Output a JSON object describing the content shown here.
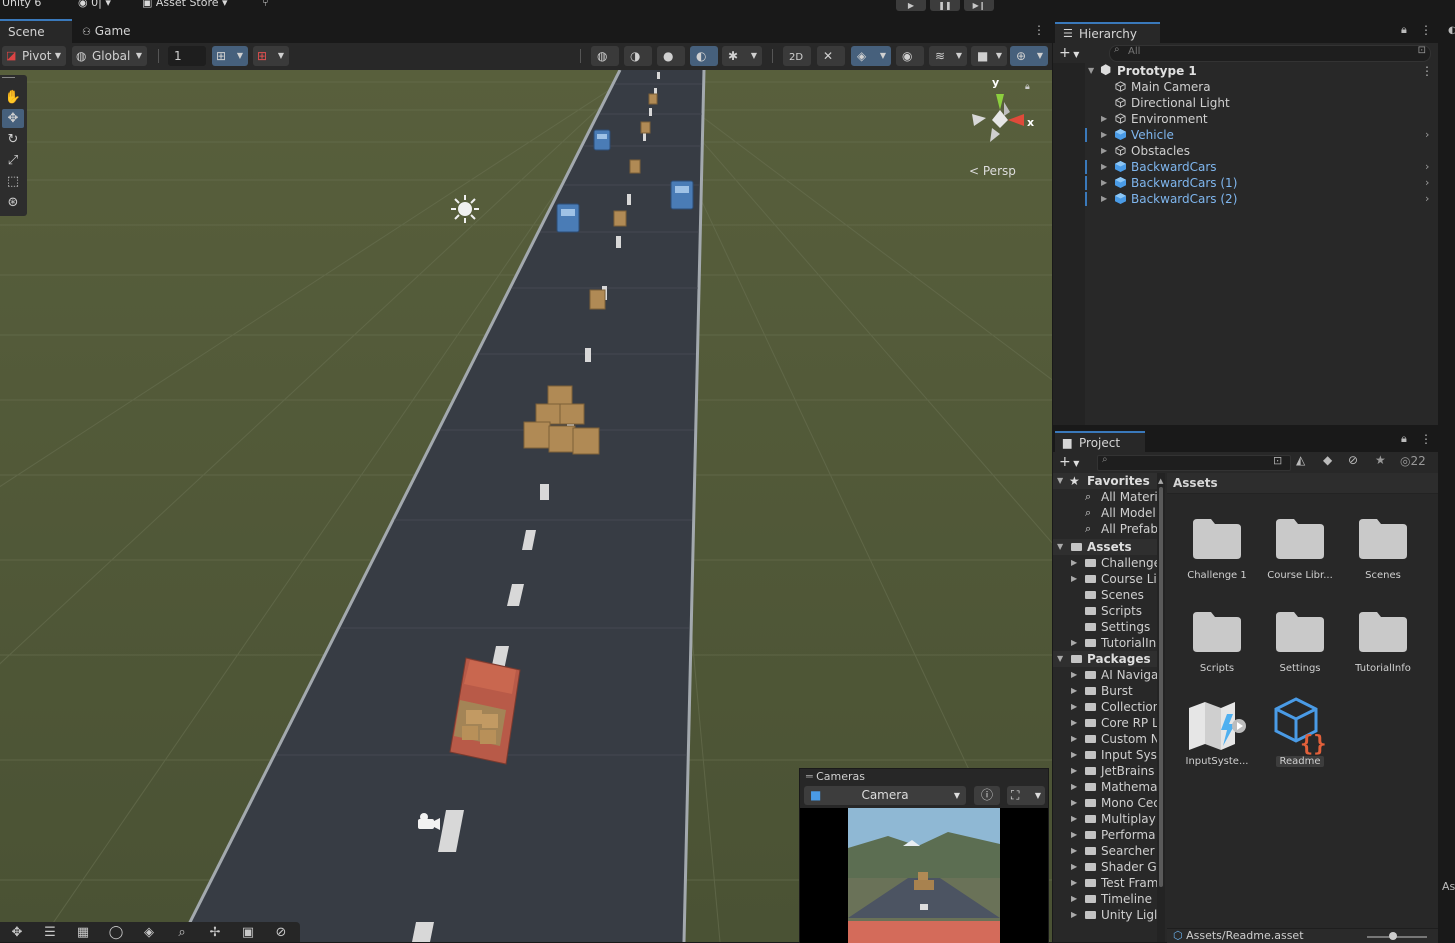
{
  "top_bar": {
    "app_title": "Unity 6",
    "account": "0|",
    "asset_store": "Asset Store"
  },
  "scene_tabs": [
    {
      "label": "Scene",
      "active": true
    },
    {
      "label": "Game",
      "active": false
    }
  ],
  "scene_toolbar": {
    "pivot_label": "Pivot",
    "global_label": "Global",
    "snap_value": "1"
  },
  "gizmo": {
    "axis_y": "y",
    "axis_x": "x",
    "projection": "Persp"
  },
  "cameras_overlay": {
    "title": "Cameras",
    "camera_select": "Camera"
  },
  "hierarchy": {
    "tab_label": "Hierarchy",
    "search_placeholder": "All",
    "scene_name": "Prototype 1",
    "items": [
      {
        "label": "Main Camera",
        "prefab": false,
        "expandable": false
      },
      {
        "label": "Directional Light",
        "prefab": false,
        "expandable": false
      },
      {
        "label": "Environment",
        "prefab": false,
        "expandable": true
      },
      {
        "label": "Vehicle",
        "prefab": true,
        "expandable": true
      },
      {
        "label": "Obstacles",
        "prefab": false,
        "expandable": true
      },
      {
        "label": "BackwardCars",
        "prefab": true,
        "expandable": true
      },
      {
        "label": "BackwardCars (1)",
        "prefab": true,
        "expandable": true
      },
      {
        "label": "BackwardCars (2)",
        "prefab": true,
        "expandable": true
      }
    ]
  },
  "project": {
    "tab_label": "Project",
    "hidden_count": "22",
    "favorites_label": "Favorites",
    "favorites": [
      "All Materi",
      "All Model",
      "All Prefab"
    ],
    "assets_label": "Assets",
    "asset_folders": [
      "Challenge",
      "Course Li",
      "Scenes",
      "Scripts",
      "Settings",
      "TutorialIn"
    ],
    "packages_label": "Packages",
    "packages": [
      "AI Naviga",
      "Burst",
      "Collection",
      "Core RP L",
      "Custom N",
      "Input Sys",
      "JetBrains",
      "Mathema",
      "Mono Cec",
      "Multiplay",
      "Performa",
      "Searcher",
      "Shader G",
      "Test Fram",
      "Timeline",
      "Unity Ligl"
    ],
    "breadcrumb": "Assets",
    "grid_items": [
      {
        "label": "Challenge 1",
        "kind": "folder"
      },
      {
        "label": "Course Libr...",
        "kind": "folder"
      },
      {
        "label": "Scenes",
        "kind": "folder"
      },
      {
        "label": "Scripts",
        "kind": "folder"
      },
      {
        "label": "Settings",
        "kind": "folder"
      },
      {
        "label": "TutorialInfo",
        "kind": "folder"
      },
      {
        "label": "InputSyste...",
        "kind": "input-actions"
      },
      {
        "label": "Readme",
        "kind": "readme"
      }
    ],
    "status_path": "Assets/Readme.asset"
  },
  "colors": {
    "accent": "#3a79bb",
    "prefab_text": "#7fb6ee",
    "panel_bg": "#282828",
    "ground": "#4e5636",
    "road": "#373c44"
  }
}
